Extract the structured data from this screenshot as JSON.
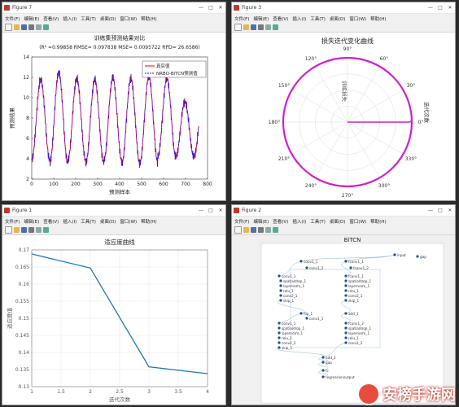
{
  "menu": [
    "文件(F)",
    "编辑(E)",
    "查看(V)",
    "插入(I)",
    "工具(T)",
    "桌面(D)",
    "窗口(W)",
    "帮助(H)"
  ],
  "window_buttons": [
    "—",
    "□",
    "✕"
  ],
  "fig7": {
    "title": "Figure 7",
    "chart_data": {
      "type": "line",
      "title": "训练集预测结果对比",
      "subtitle": "(R² =0.99858 RMSE= 0.097838 MSE= 0.0095722 RPD= 26.6586)",
      "xlabel": "预测样本",
      "ylabel": "预测结果",
      "xlim": [
        0,
        800
      ],
      "ylim": [
        2,
        14
      ],
      "xticks": [
        "0",
        "100",
        "200",
        "300",
        "400",
        "500",
        "600",
        "700",
        "800"
      ],
      "yticks": [
        "2",
        "4",
        "6",
        "8",
        "10",
        "12",
        "14"
      ],
      "legend_position": "top-right",
      "series": [
        {
          "name": "真实值",
          "color": "#ff0000"
        },
        {
          "name": "NRBO-BiTCN预测值",
          "color": "#1a1aff"
        }
      ],
      "cycle_peaks": [
        11.8,
        12.5,
        11.9,
        11.8,
        12.0,
        11.9,
        12.1,
        11.9,
        9.6
      ],
      "cycle_troughs": [
        3.9,
        3.6,
        3.8,
        3.6,
        3.8,
        3.5,
        3.6,
        4.2
      ],
      "period": 82,
      "grid": false
    }
  },
  "fig3": {
    "title": "Figure 3",
    "chart_data": {
      "type": "polar",
      "title": "损失迭代变化曲线",
      "radial_label": "训练损失",
      "angle_label": "迭代次数",
      "angle_ticks": [
        "0°",
        "30°",
        "60°",
        "90°",
        "120°",
        "150°",
        "180°",
        "210°",
        "240°",
        "270°",
        "300°",
        "330°"
      ],
      "line_color": "#cc22cc",
      "grid": true
    }
  },
  "fig1": {
    "title": "Figure 1",
    "chart_data": {
      "type": "line",
      "title": "适应度曲线",
      "xlabel": "迭代次数",
      "ylabel": "适应度值",
      "x": [
        1,
        2,
        3,
        4
      ],
      "y": [
        0.1688,
        0.1647,
        0.1358,
        0.1338
      ],
      "xlim": [
        1,
        4
      ],
      "ylim": [
        0.13,
        0.17
      ],
      "xticks": [
        "1",
        "1.5",
        "2",
        "2.5",
        "3",
        "3.5",
        "4"
      ],
      "yticks": [
        "0.13",
        "0.135",
        "0.14",
        "0.145",
        "0.15",
        "0.155",
        "0.16",
        "0.165",
        "0.17"
      ],
      "line_color": "#1f77b4",
      "grid": true
    }
  },
  "fig2": {
    "title": "Figure 2",
    "chart_data": {
      "type": "diagram",
      "title": "BiTCN",
      "node_labels": [
        "input",
        "conv1_1",
        "conv1_2",
        "spatialdrop_1",
        "layernorm_1",
        "relu_1",
        "skip_1",
        "flip_1",
        "fconv1_1",
        "fconv1_2",
        "conv2_1",
        "conv2_2",
        "add_1",
        "add_2",
        "gap",
        "fc",
        "regressionoutput"
      ]
    }
  },
  "watermark": {
    "text": "安榜手游网"
  }
}
